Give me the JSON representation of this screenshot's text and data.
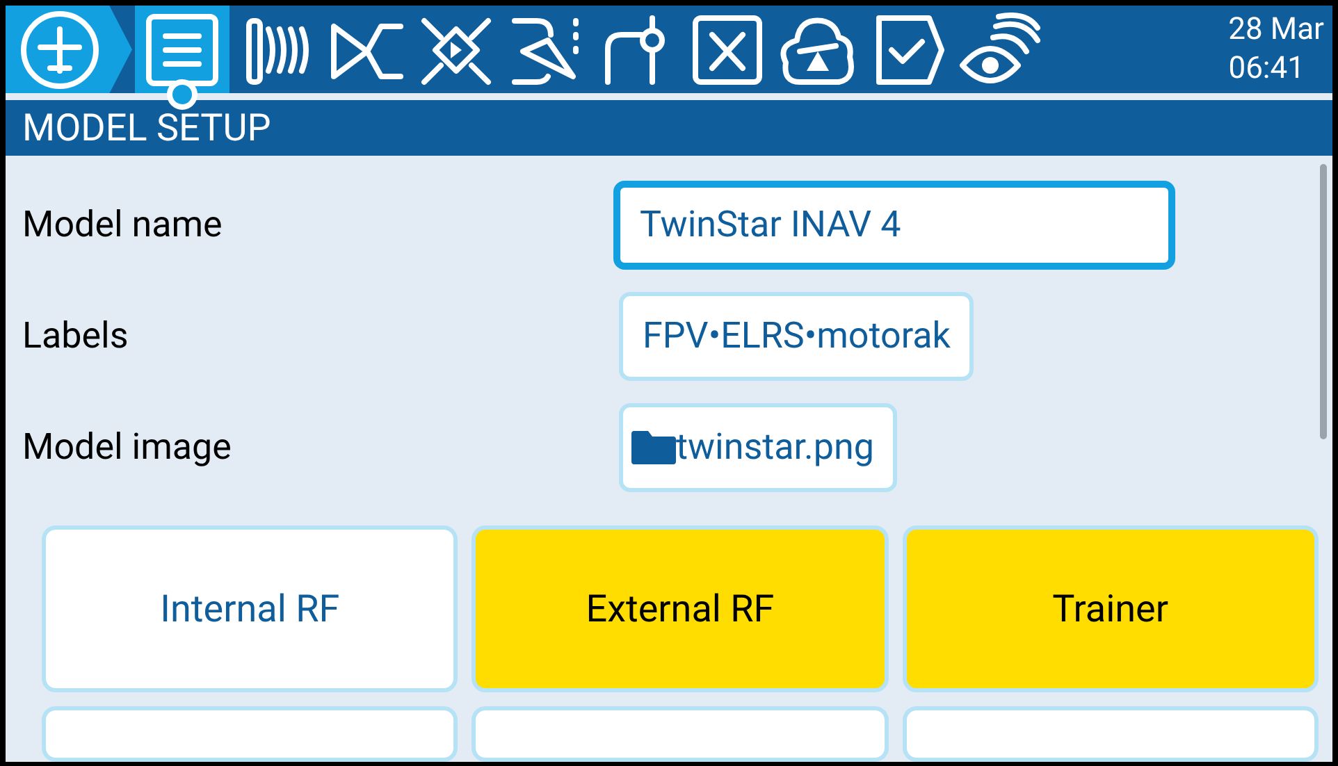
{
  "tabs": [
    {
      "kind": "home",
      "selected": false
    },
    {
      "kind": "setup",
      "selected": true
    },
    {
      "kind": "waves",
      "selected": false
    },
    {
      "kind": "mixer",
      "selected": false
    },
    {
      "kind": "cross",
      "selected": false
    },
    {
      "kind": "curve",
      "selected": false
    },
    {
      "kind": "logic",
      "selected": false
    },
    {
      "kind": "variable",
      "selected": false
    },
    {
      "kind": "cloud",
      "selected": false
    },
    {
      "kind": "check",
      "selected": false
    },
    {
      "kind": "telemetry",
      "selected": false
    }
  ],
  "clock": {
    "date": "28 Mar",
    "time": "06:41"
  },
  "page_title": "MODEL SETUP",
  "fields": [
    {
      "label": "Model name",
      "value": "TwinStar INAV 4",
      "focused": true
    },
    {
      "label": "Labels",
      "value": "FPV•ELRS•motorak",
      "focused": false
    },
    {
      "label": "Model image",
      "value": "twinstar.png",
      "kind": "file",
      "focused": false
    }
  ],
  "modules": [
    {
      "label": "Internal RF",
      "enabled": false
    },
    {
      "label": "External RF",
      "enabled": true
    },
    {
      "label": "Trainer",
      "enabled": true
    }
  ]
}
